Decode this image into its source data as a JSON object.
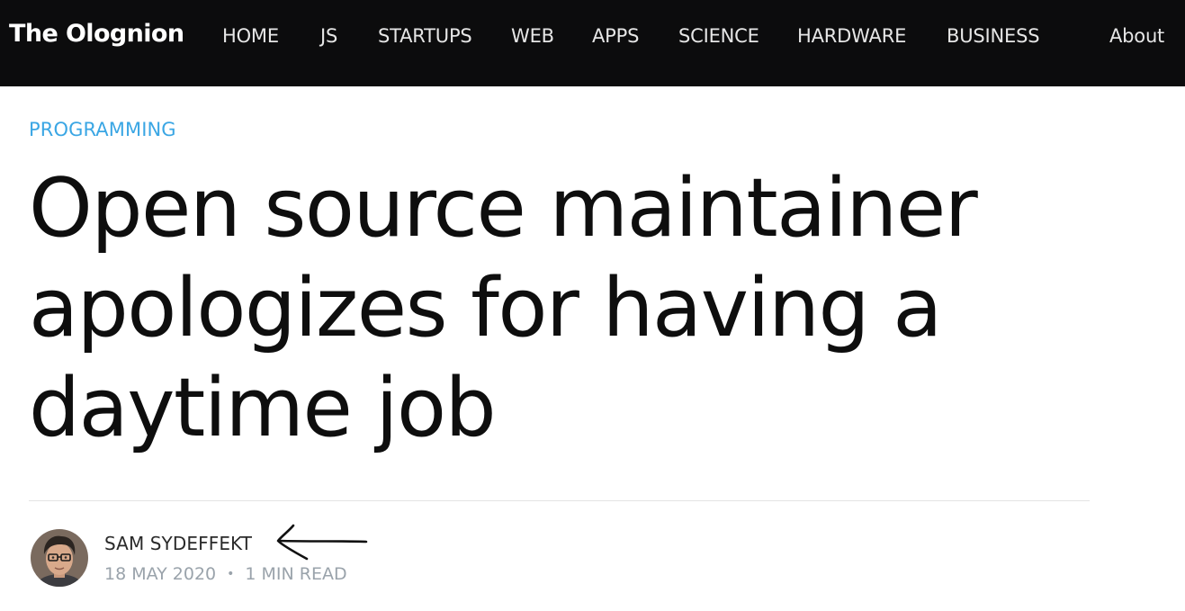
{
  "site": {
    "brand": "The Olognion"
  },
  "nav": {
    "items": [
      {
        "label": "HOME"
      },
      {
        "label": "JS"
      },
      {
        "label": "STARTUPS"
      },
      {
        "label": "WEB"
      },
      {
        "label": "APPS"
      },
      {
        "label": "SCIENCE"
      },
      {
        "label": "HARDWARE"
      },
      {
        "label": "BUSINESS"
      }
    ],
    "about": "About"
  },
  "article": {
    "category": "PROGRAMMING",
    "title_lines": [
      "Open source maintainer",
      "apologizes for having a",
      "daytime job"
    ],
    "author": "SAM SYDEFFEKT",
    "date": "18 MAY 2020",
    "separator": "•",
    "read_time": "1 MIN READ"
  },
  "colors": {
    "nav_background": "#0c0c0d",
    "category_accent": "#3aa6e4",
    "meta_text": "#9aa3ab"
  },
  "icons": {
    "author_avatar": "author-avatar",
    "annotation_arrow": "left-arrow-annotation"
  }
}
